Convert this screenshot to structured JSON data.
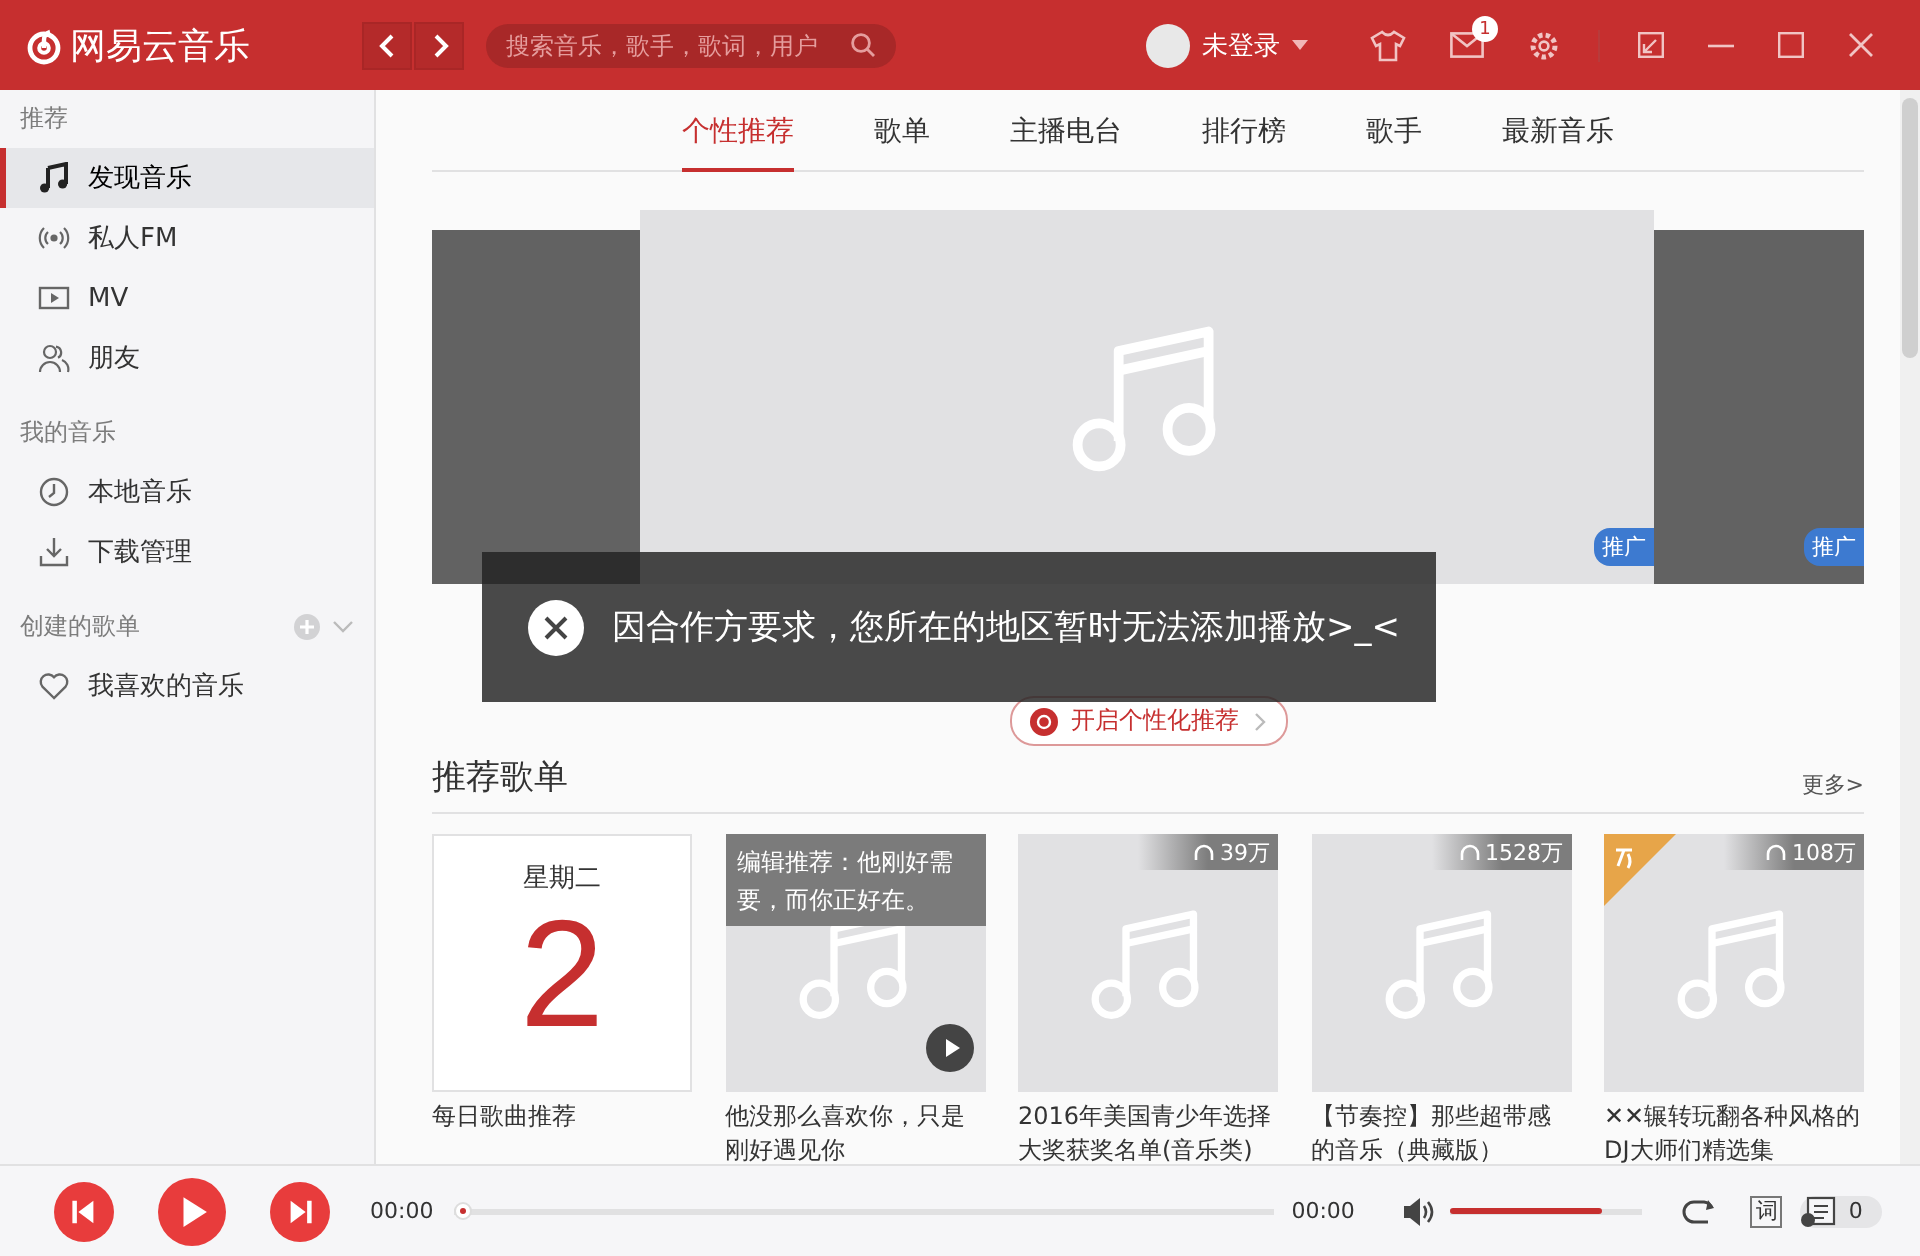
{
  "header": {
    "logo_text": "网易云音乐",
    "search": {
      "placeholder": "搜索音乐，歌手，歌词，用户"
    },
    "user": "未登录",
    "mail_badge": "1"
  },
  "sidebar": {
    "sections": [
      {
        "title": "推荐",
        "items": [
          {
            "label": "发现音乐",
            "selected": true
          },
          {
            "label": "私人FM",
            "selected": false
          },
          {
            "label": "MV",
            "selected": false
          },
          {
            "label": "朋友",
            "selected": false
          }
        ]
      },
      {
        "title": "我的音乐",
        "items": [
          {
            "label": "本地音乐",
            "selected": false
          },
          {
            "label": "下载管理",
            "selected": false
          }
        ]
      },
      {
        "title": "创建的歌单",
        "items": [
          {
            "label": "我喜欢的音乐",
            "selected": false
          }
        ]
      }
    ]
  },
  "tabs": {
    "items": [
      {
        "label": "个性推荐",
        "selected": true
      },
      {
        "label": "歌单",
        "selected": false
      },
      {
        "label": "主播电台",
        "selected": false
      },
      {
        "label": "排行榜",
        "selected": false
      },
      {
        "label": "歌手",
        "selected": false
      },
      {
        "label": "最新音乐",
        "selected": false
      }
    ]
  },
  "banner": {
    "badges": [
      "推广",
      "推广"
    ],
    "toggle_button": "开启个性化推荐",
    "toast": "因合作方要求，您所在的地区暂时无法添加播放>_<"
  },
  "playlists": {
    "title": "推荐歌单",
    "more": "更多>",
    "cards": [
      {
        "kind": "daily",
        "weekday": "星期二",
        "day": "2",
        "caption": "每日歌曲推荐"
      },
      {
        "kind": "editorial",
        "note": "编辑推荐：他刚好需要，而你正好在。",
        "caption": "他没那么喜欢你，只是刚好遇见你"
      },
      {
        "kind": "playlist",
        "plays": "39万",
        "tagged": false,
        "caption": "2016年美国青少年选择大奖获奖名单(音乐类)"
      },
      {
        "kind": "playlist",
        "plays": "1528万",
        "tagged": false,
        "caption": "【节奏控】那些超带感的音乐（典藏版）"
      },
      {
        "kind": "playlist",
        "plays": "108万",
        "tagged": true,
        "caption": "✕✕辗转玩翻各种风格的DJ大师们精选集"
      }
    ]
  },
  "player": {
    "elapsed": "00:00",
    "duration": "00:00",
    "progress": {
      "level": 0
    },
    "volume": {
      "level": 0.79
    },
    "lyrics_button": "词",
    "queue_count": "0"
  }
}
